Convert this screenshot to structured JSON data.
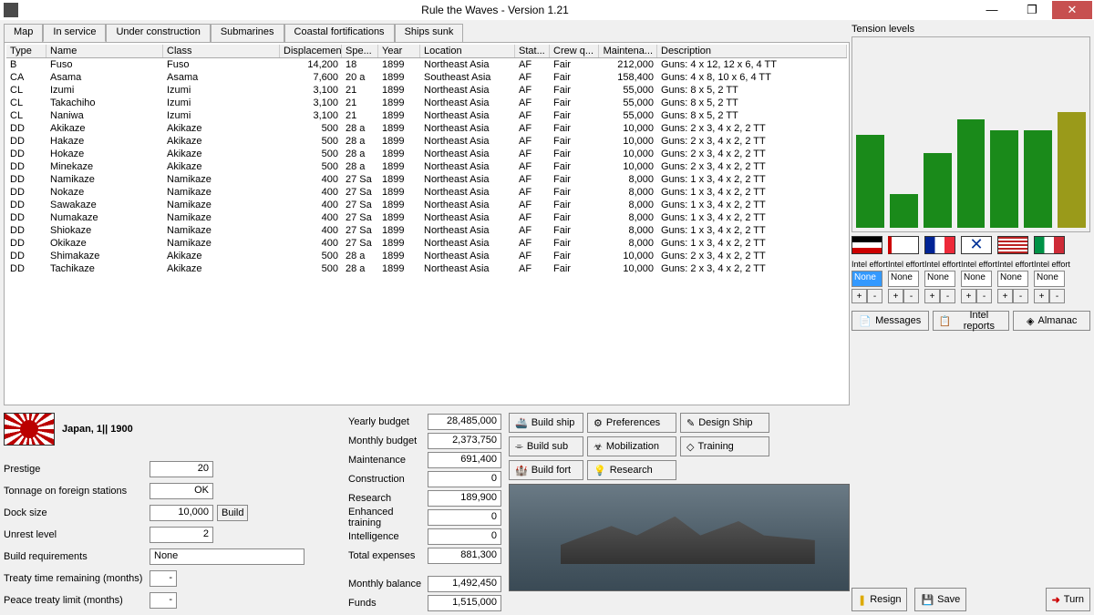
{
  "window": {
    "title": "Rule the Waves - Version 1.21",
    "min": "—",
    "max": "❐",
    "close": "✕"
  },
  "tabs": [
    "Map",
    "In service",
    "Under construction",
    "Submarines",
    "Coastal fortifications",
    "Ships sunk"
  ],
  "active_tab": 1,
  "columns": [
    "Type",
    "Name",
    "Class",
    "Displacement",
    "Spe...",
    "Year",
    "Location",
    "Stat...",
    "Crew q...",
    "Maintena...",
    "Description"
  ],
  "ships": [
    {
      "type": "B",
      "name": "Fuso",
      "class": "Fuso",
      "disp": "14,200",
      "spe": "18",
      "year": "1899",
      "loc": "Northeast Asia",
      "stat": "AF",
      "crew": "Fair",
      "maint": "212,000",
      "desc": "Guns: 4 x 12, 12 x 6, 4 TT"
    },
    {
      "type": "CA",
      "name": "Asama",
      "class": "Asama",
      "disp": "7,600",
      "spe": "20 a",
      "year": "1899",
      "loc": "Southeast Asia",
      "stat": "AF",
      "crew": "Fair",
      "maint": "158,400",
      "desc": "Guns: 4 x 8, 10 x 6, 4 TT"
    },
    {
      "type": "CL",
      "name": "Izumi",
      "class": "Izumi",
      "disp": "3,100",
      "spe": "21",
      "year": "1899",
      "loc": "Northeast Asia",
      "stat": "AF",
      "crew": "Fair",
      "maint": "55,000",
      "desc": "Guns: 8 x 5, 2 TT"
    },
    {
      "type": "CL",
      "name": "Takachiho",
      "class": "Izumi",
      "disp": "3,100",
      "spe": "21",
      "year": "1899",
      "loc": "Northeast Asia",
      "stat": "AF",
      "crew": "Fair",
      "maint": "55,000",
      "desc": "Guns: 8 x 5, 2 TT"
    },
    {
      "type": "CL",
      "name": "Naniwa",
      "class": "Izumi",
      "disp": "3,100",
      "spe": "21",
      "year": "1899",
      "loc": "Northeast Asia",
      "stat": "AF",
      "crew": "Fair",
      "maint": "55,000",
      "desc": "Guns: 8 x 5, 2 TT"
    },
    {
      "type": "DD",
      "name": "Akikaze",
      "class": "Akikaze",
      "disp": "500",
      "spe": "28 a",
      "year": "1899",
      "loc": "Northeast Asia",
      "stat": "AF",
      "crew": "Fair",
      "maint": "10,000",
      "desc": "Guns: 2 x 3, 4 x 2, 2 TT"
    },
    {
      "type": "DD",
      "name": "Hakaze",
      "class": "Akikaze",
      "disp": "500",
      "spe": "28 a",
      "year": "1899",
      "loc": "Northeast Asia",
      "stat": "AF",
      "crew": "Fair",
      "maint": "10,000",
      "desc": "Guns: 2 x 3, 4 x 2, 2 TT"
    },
    {
      "type": "DD",
      "name": "Hokaze",
      "class": "Akikaze",
      "disp": "500",
      "spe": "28 a",
      "year": "1899",
      "loc": "Northeast Asia",
      "stat": "AF",
      "crew": "Fair",
      "maint": "10,000",
      "desc": "Guns: 2 x 3, 4 x 2, 2 TT"
    },
    {
      "type": "DD",
      "name": "Minekaze",
      "class": "Akikaze",
      "disp": "500",
      "spe": "28 a",
      "year": "1899",
      "loc": "Northeast Asia",
      "stat": "AF",
      "crew": "Fair",
      "maint": "10,000",
      "desc": "Guns: 2 x 3, 4 x 2, 2 TT"
    },
    {
      "type": "DD",
      "name": "Namikaze",
      "class": "Namikaze",
      "disp": "400",
      "spe": "27 Sa",
      "year": "1899",
      "loc": "Northeast Asia",
      "stat": "AF",
      "crew": "Fair",
      "maint": "8,000",
      "desc": "Guns: 1 x 3, 4 x 2, 2 TT"
    },
    {
      "type": "DD",
      "name": "Nokaze",
      "class": "Namikaze",
      "disp": "400",
      "spe": "27 Sa",
      "year": "1899",
      "loc": "Northeast Asia",
      "stat": "AF",
      "crew": "Fair",
      "maint": "8,000",
      "desc": "Guns: 1 x 3, 4 x 2, 2 TT"
    },
    {
      "type": "DD",
      "name": "Sawakaze",
      "class": "Namikaze",
      "disp": "400",
      "spe": "27 Sa",
      "year": "1899",
      "loc": "Northeast Asia",
      "stat": "AF",
      "crew": "Fair",
      "maint": "8,000",
      "desc": "Guns: 1 x 3, 4 x 2, 2 TT"
    },
    {
      "type": "DD",
      "name": "Numakaze",
      "class": "Namikaze",
      "disp": "400",
      "spe": "27 Sa",
      "year": "1899",
      "loc": "Northeast Asia",
      "stat": "AF",
      "crew": "Fair",
      "maint": "8,000",
      "desc": "Guns: 1 x 3, 4 x 2, 2 TT"
    },
    {
      "type": "DD",
      "name": "Shiokaze",
      "class": "Namikaze",
      "disp": "400",
      "spe": "27 Sa",
      "year": "1899",
      "loc": "Northeast Asia",
      "stat": "AF",
      "crew": "Fair",
      "maint": "8,000",
      "desc": "Guns: 1 x 3, 4 x 2, 2 TT"
    },
    {
      "type": "DD",
      "name": "Okikaze",
      "class": "Namikaze",
      "disp": "400",
      "spe": "27 Sa",
      "year": "1899",
      "loc": "Northeast Asia",
      "stat": "AF",
      "crew": "Fair",
      "maint": "8,000",
      "desc": "Guns: 1 x 3, 4 x 2, 2 TT"
    },
    {
      "type": "DD",
      "name": "Shimakaze",
      "class": "Akikaze",
      "disp": "500",
      "spe": "28 a",
      "year": "1899",
      "loc": "Northeast Asia",
      "stat": "AF",
      "crew": "Fair",
      "maint": "10,000",
      "desc": "Guns: 2 x 3, 4 x 2, 2 TT"
    },
    {
      "type": "DD",
      "name": "Tachikaze",
      "class": "Akikaze",
      "disp": "500",
      "spe": "28 a",
      "year": "1899",
      "loc": "Northeast Asia",
      "stat": "AF",
      "crew": "Fair",
      "maint": "10,000",
      "desc": "Guns: 2 x 3, 4 x 2, 2 TT"
    }
  ],
  "nation": {
    "label": "Japan, 1|| 1900"
  },
  "stats": {
    "prestige_l": "Prestige",
    "prestige": "20",
    "foreign_l": "Tonnage on foreign stations",
    "foreign": "OK",
    "dock_l": "Dock size",
    "dock": "10,000",
    "build_btn": "Build",
    "unrest_l": "Unrest level",
    "unrest": "2",
    "req_l": "Build requirements",
    "req": "None",
    "treaty_l": "Treaty time remaining (months)",
    "treaty": "-",
    "peace_l": "Peace treaty limit (months)",
    "peace": "-"
  },
  "budget": {
    "yb_l": "Yearly budget",
    "yb": "28,485,000",
    "mb_l": "Monthly budget",
    "mb": "2,373,750",
    "mn_l": "Maintenance",
    "mn": "691,400",
    "cn_l": "Construction",
    "cn": "0",
    "rs_l": "Research",
    "rs": "189,900",
    "et_l": "Enhanced training",
    "et": "0",
    "in_l": "Intelligence",
    "in": "0",
    "te_l": "Total expenses",
    "te": "881,300",
    "bal_l": "Monthly balance",
    "bal": "1,492,450",
    "fn_l": "Funds",
    "fn": "1,515,000"
  },
  "actions": {
    "build_ship": "Build ship",
    "build_sub": "Build sub",
    "build_fort": "Build fort",
    "prefs": "Preferences",
    "mob": "Mobilization",
    "research": "Research",
    "design": "Design Ship",
    "training": "Training"
  },
  "tension": {
    "title": "Tension levels",
    "bars": [
      50,
      18,
      40,
      58,
      52,
      52,
      62
    ],
    "colors": [
      "#1a8a1a",
      "#1a8a1a",
      "#1a8a1a",
      "#1a8a1a",
      "#1a8a1a",
      "#1a8a1a",
      "#9a9a1a"
    ]
  },
  "intel": {
    "label": "Intel effort",
    "values": [
      "None",
      "None",
      "None",
      "None",
      "None",
      "None"
    ],
    "plus": "+",
    "minus": "-"
  },
  "msg": {
    "messages": "Messages",
    "reports": "Intel reports",
    "almanac": "Almanac"
  },
  "end": {
    "resign": "Resign",
    "save": "Save",
    "turn": "Turn"
  }
}
